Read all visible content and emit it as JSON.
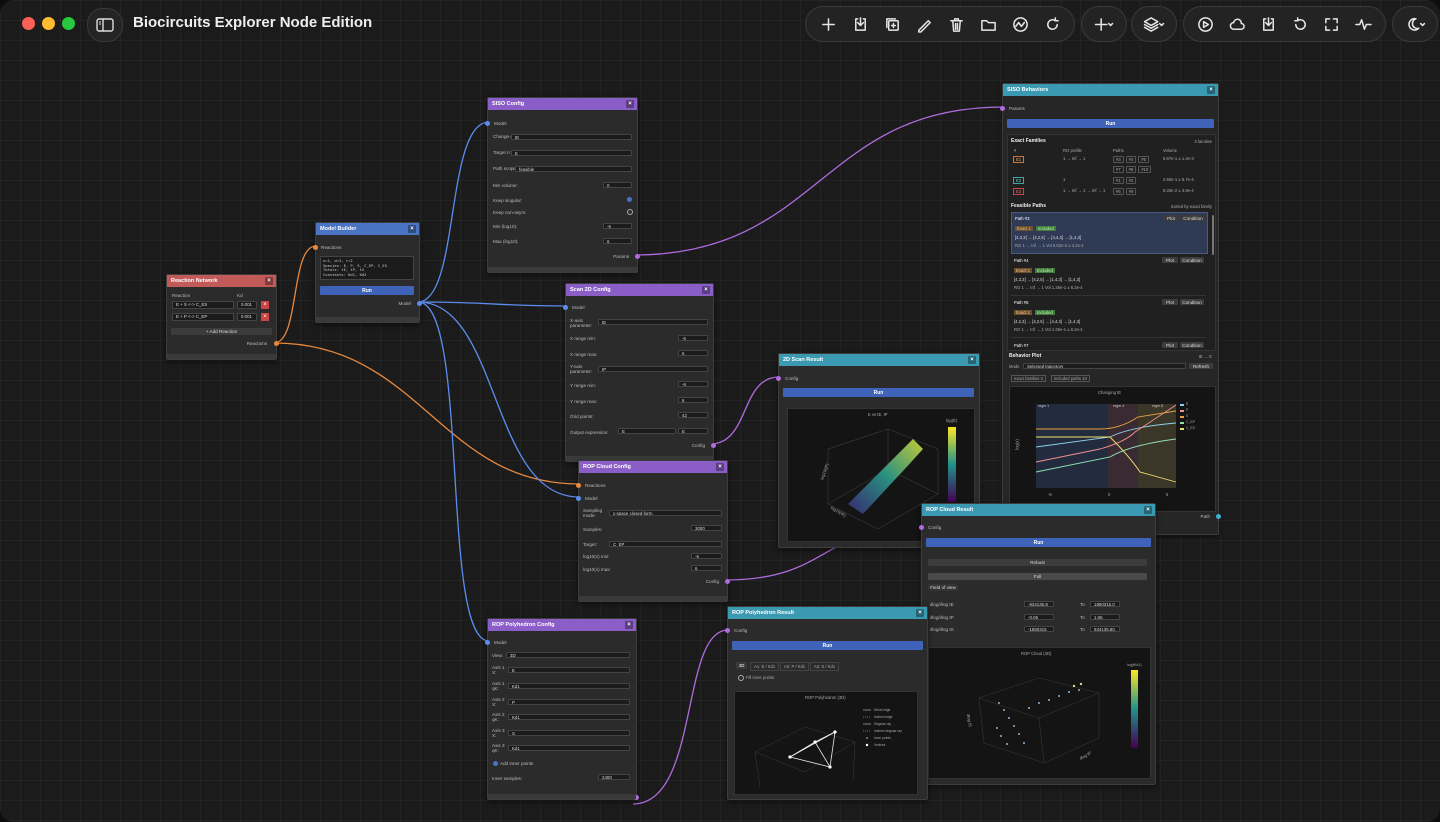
{
  "app": {
    "title": "Biocircuits Explorer Node Edition"
  },
  "toolbar": {
    "group1": [
      "add-icon",
      "import-icon",
      "duplicate-icon",
      "edit-icon",
      "delete-icon",
      "folder-icon",
      "chart-icon",
      "refresh-icon"
    ],
    "group2": [
      "add-menu-icon"
    ],
    "group3": [
      "layers-icon"
    ],
    "group4": [
      "play-icon",
      "cloud-icon",
      "download-icon",
      "undo-icon",
      "fullscreen-icon",
      "activity-icon"
    ],
    "group5": [
      "theme-icon"
    ]
  },
  "reaction_network": {
    "title": "Reaction Network",
    "col_reaction": "Reaction",
    "col_kd": "Kd",
    "rows": [
      {
        "reaction": "E + S <-> C_ES",
        "kd": "0.001"
      },
      {
        "reaction": "E + P <-> C_EP",
        "kd": "0.001"
      }
    ],
    "add_label": "+ Add Reaction",
    "out_label": "Reactions"
  },
  "model_builder": {
    "title": "Model Builder",
    "in_label": "Reactions",
    "code": [
      "n=1, d=3, r=2",
      "Species: E, P, S, C_EP, C_ES",
      "Totals: tE, tP, tS",
      "Constants: Kd1, Kd2"
    ],
    "run": "Run",
    "out_label": "Model"
  },
  "siso_config": {
    "title": "SISO Config",
    "in_label": "Model",
    "fields": [
      {
        "label": "Change qK:",
        "value": "tE"
      },
      {
        "label": "Target n:",
        "value": "E"
      },
      {
        "label": "Path scope:",
        "value": "feasible"
      },
      {
        "label": "Min volume:",
        "value": "0"
      }
    ],
    "keep_singular": "Keep singular:",
    "keep_nonasym": "Keep non-asym:",
    "min_log": "Min (log10):",
    "min_log_val": "-6",
    "max_log": "Max (log10):",
    "max_log_val": "6",
    "out_label": "Params"
  },
  "scan2d_config": {
    "title": "Scan 2D Config",
    "in_label": "Model",
    "fields": [
      {
        "label": "X-axis parameter:",
        "value": "tE"
      },
      {
        "label": "X range min:",
        "value": "-6"
      },
      {
        "label": "X range max:",
        "value": "6"
      },
      {
        "label": "Y-axis parameter:",
        "value": "tP"
      },
      {
        "label": "Y range min:",
        "value": "-6"
      },
      {
        "label": "Y range max:",
        "value": "6"
      },
      {
        "label": "Grid points:",
        "value": "42"
      },
      {
        "label": "Output expression:",
        "value": "E"
      }
    ],
    "out_label": "Config"
  },
  "rop_cloud_config": {
    "title": "ROP Cloud Config",
    "in1": "Reactions",
    "in2": "Model",
    "fields": [
      {
        "label": "Sampling mode:",
        "value": "x-space closed-form"
      },
      {
        "label": "Samples:",
        "value": "3000"
      },
      {
        "label": "Target:",
        "value": "C_EP"
      },
      {
        "label": "log10(x) min:",
        "value": "-6"
      },
      {
        "label": "log10(x) max:",
        "value": "6"
      }
    ],
    "out_label": "Config"
  },
  "rop_poly_config": {
    "title": "ROP Polyhedron Config",
    "in_label": "Model",
    "fields": [
      {
        "label": "View:",
        "value": "3D"
      },
      {
        "label": "Axis 1 X:",
        "value": "E"
      },
      {
        "label": "Axis 1 qK:",
        "value": "Kd1"
      },
      {
        "label": "Axis 2 X:",
        "value": "P"
      },
      {
        "label": "Axis 2 qK:",
        "value": "Kd1"
      },
      {
        "label": "Axis 3 X:",
        "value": "S"
      },
      {
        "label": "Axis 3 qK:",
        "value": "Kd1"
      }
    ],
    "add_inner": "Add inner points",
    "inner_samples": "Inner samples:",
    "inner_samples_val": "2400"
  },
  "scan2d_result": {
    "title": "2D Scan Result",
    "in_label": "Config",
    "run": "Run",
    "plot_title": "E vs tE, tP",
    "cbar_label": "log(E)",
    "ylabel": "log10(tP)",
    "xlabel": "log10(tE)"
  },
  "siso_behaviors": {
    "title": "SISO Behaviors",
    "in_label": "Params",
    "run": "Run",
    "exact_title": "Exact Families",
    "exact_count": "3 families",
    "exact_cols": [
      "#",
      "RO profile",
      "Paths",
      "Volume"
    ],
    "exact_rows": [
      {
        "id": "E1",
        "ro": "1 → Inf → 1",
        "paths": [
          "#3",
          "#4",
          "#5",
          "#7",
          "#8",
          "#10"
        ],
        "volume": "6.67e-1 ± 1.4e-3"
      },
      {
        "id": "E2",
        "ro": "1",
        "paths": [
          "#1",
          "#2"
        ],
        "volume": "2.50e-1 ± 8.7e-4"
      },
      {
        "id": "E3",
        "ro": "1 → Inf → 1 → Inf → 1",
        "paths": [
          "#6",
          "#9"
        ],
        "volume": "8.33e-2 ± 3.9e-4"
      }
    ],
    "feasible_title": "Feasible Paths",
    "feasible_sort": "Sorted by exact family",
    "paths": [
      {
        "name": "Path #3",
        "badge": "Exact 1",
        "included": "Included",
        "seq": "[4,3,3] → [4,2,5] → [4,4,3] → [1,4,3]",
        "ro": "RO 1 → Inf → 1   Vol 6.52e-2 ± 4.2e-4"
      },
      {
        "name": "Path #4",
        "badge": "Exact 1",
        "included": "Included",
        "seq": "[4,3,3] → [4,2,5] → [1,4,3] → [1,4,3]",
        "ro": "RO 1 → Inf → 1   Vol 1.26e-1 ± 6.2e-4"
      },
      {
        "name": "Path #5",
        "badge": "Exact 1",
        "included": "Included",
        "seq": "[4,2,3] → [4,2,5] → [4,4,3] → [1,4,3]",
        "ro": "RO 1 → Inf → 1   Vol 1.26e-1 ± 6.2e-4"
      },
      {
        "name": "Path #7",
        "badge": "",
        "included": "",
        "seq": "",
        "ro": ""
      }
    ],
    "plot_btn": "Plot",
    "condition_btn": "Condition",
    "behavior_title": "Behavior Plot",
    "behavior_sub": "tE → E",
    "mode_label": "Mode",
    "mode_value": "Selected trajectory",
    "refresh": "Refresh",
    "exact_families_chip": "exact families 3",
    "included_paths_chip": "included paths 10",
    "plot_title": "Changing tE",
    "regions": [
      "regm 1",
      "regm 4",
      "regm 8"
    ],
    "ylabel": "log(x)",
    "xticks": [
      "-5",
      "0",
      "5"
    ],
    "legend": [
      "E",
      "P",
      "S",
      "C_EP",
      "C_ES"
    ],
    "out_label": "Path"
  },
  "rop_cloud_result": {
    "title": "ROP Cloud Result",
    "in_label": "Config",
    "run": "Run",
    "robust": "Robust",
    "full": "Full",
    "fov": "Field of view",
    "rows": [
      {
        "label": "∂log/∂log tE",
        "from": "-934135.8",
        "to": "1850315.0"
      },
      {
        "label": "∂log/∂log tP",
        "from": "-0.06",
        "to": "1.06"
      },
      {
        "label": "∂log/∂log tS",
        "from": "-1850315",
        "to": "934135.80"
      }
    ],
    "to_label": "To",
    "plot_title": "ROP Cloud (3D)",
    "cbar_label": "log(tKd1)",
    "axis_label_a": "∂log tS",
    "axis_label_b": "∂log tP"
  },
  "rop_poly_result": {
    "title": "ROP Polyhedron Result",
    "in_label": "Config",
    "run": "Run",
    "tabs": [
      "3D",
      "A1: E / Kd1",
      "A2: P / Kd1",
      "A3: S / Kd1"
    ],
    "fill_inner": "Fill inner points",
    "plot_title": "ROP Polyhedron (3D)",
    "legend": [
      "Direct edge",
      "Indirect edge",
      "Singular ray",
      "Indirect singular ray",
      "Inner points",
      "Vertices"
    ]
  }
}
